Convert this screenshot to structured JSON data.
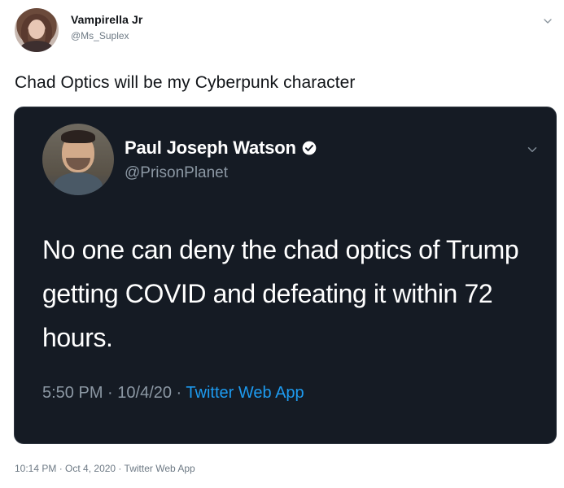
{
  "outer_tweet": {
    "display_name": "Vampirella Jr",
    "handle": "@Ms_Suplex",
    "text": "Chad Optics will be my Cyberpunk character",
    "timestamp": "10:14 PM",
    "date": "Oct 4, 2020",
    "source": "Twitter Web App"
  },
  "quoted_tweet": {
    "display_name": "Paul Joseph Watson",
    "handle": "@PrisonPlanet",
    "text": "No one can deny the chad optics of Trump getting COVID and defeating it within 72 hours.",
    "timestamp": "5:50 PM",
    "date": "10/4/20",
    "source": "Twitter Web App",
    "verified": true
  },
  "separators": {
    "dot": " · "
  },
  "icons": {
    "outer_more": "chevron-down-icon",
    "quote_more": "chevron-down-icon",
    "verified": "verified-badge-icon"
  },
  "colors": {
    "quote_background": "#151b24",
    "link_blue": "#1d9bf0",
    "secondary_text": "#8c98a4"
  }
}
